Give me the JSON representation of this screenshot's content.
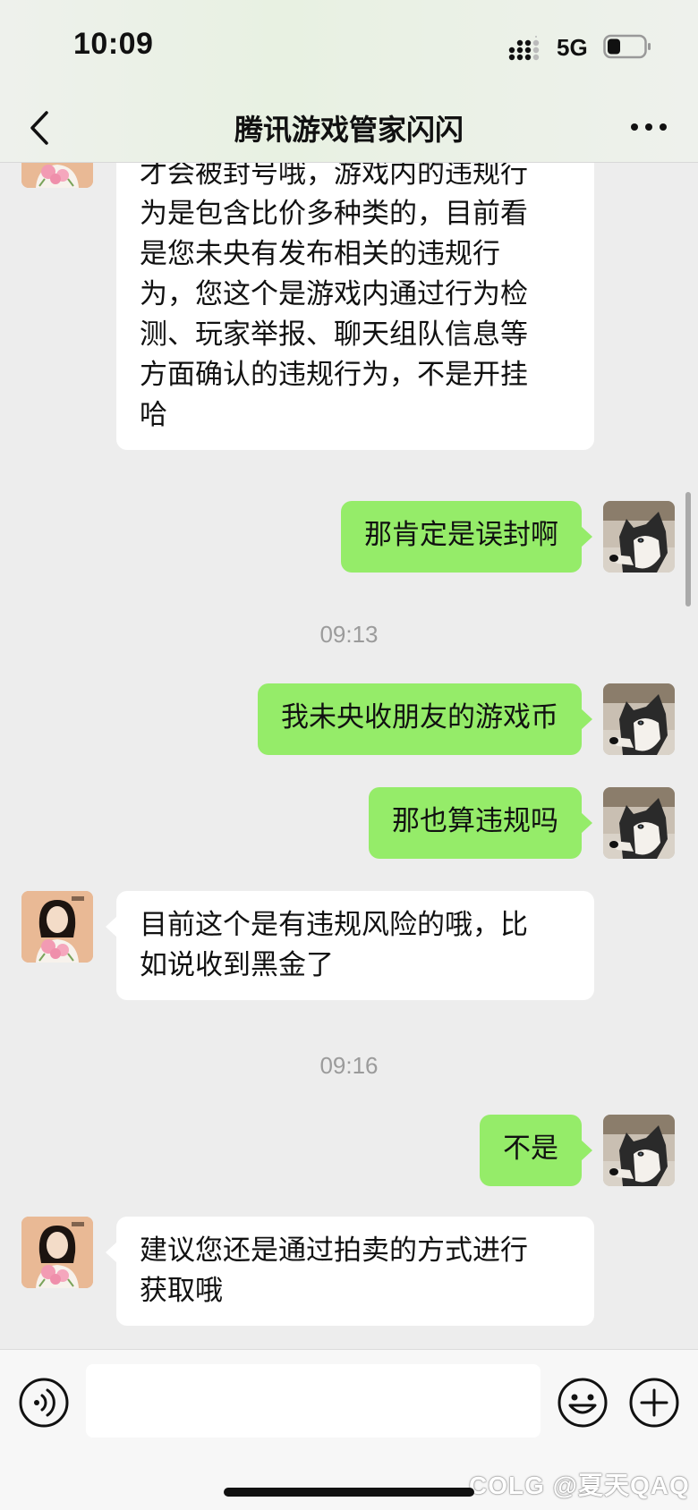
{
  "status_bar": {
    "time": "10:09",
    "network": "5G"
  },
  "header": {
    "title": "腾讯游戏管家闪闪"
  },
  "messages": [
    {
      "side": "in",
      "lines": [
        "才会被封号哦，游戏内的违规行",
        "为是包含比价多种类的，目前看",
        "是您未央有发布相关的违规行",
        "为，您这个是游戏内通过行为检",
        "测、玩家举报、聊天组队信息等",
        "方面确认的违规行为，不是开挂",
        "哈"
      ]
    },
    {
      "side": "out",
      "lines": [
        "那肯定是误封啊"
      ]
    },
    {
      "timestamp": "09:13"
    },
    {
      "side": "out",
      "lines": [
        "我未央收朋友的游戏币"
      ]
    },
    {
      "side": "out",
      "lines": [
        "那也算违规吗"
      ]
    },
    {
      "side": "in",
      "lines": [
        "目前这个是有违规风险的哦，比",
        "如说收到黑金了"
      ]
    },
    {
      "timestamp": "09:16"
    },
    {
      "side": "out",
      "lines": [
        "不是"
      ]
    },
    {
      "side": "in",
      "lines": [
        "建议您还是通过拍卖的方式进行",
        "获取哦"
      ]
    }
  ],
  "input": {
    "value": "",
    "placeholder": ""
  },
  "watermark": "COLG @夏天QAQ",
  "colors": {
    "chat_bg": "#ededed",
    "outgoing_bubble": "#95ec69",
    "incoming_bubble": "#ffffff",
    "timestamp_text": "#9b9b9b"
  },
  "icons": {
    "back": "chevron-left-icon",
    "more": "more-dots-icon",
    "voice": "voice-icon",
    "emoji": "emoji-icon",
    "plus": "plus-icon",
    "signal": "cellular-signal-icon",
    "battery": "battery-icon"
  }
}
